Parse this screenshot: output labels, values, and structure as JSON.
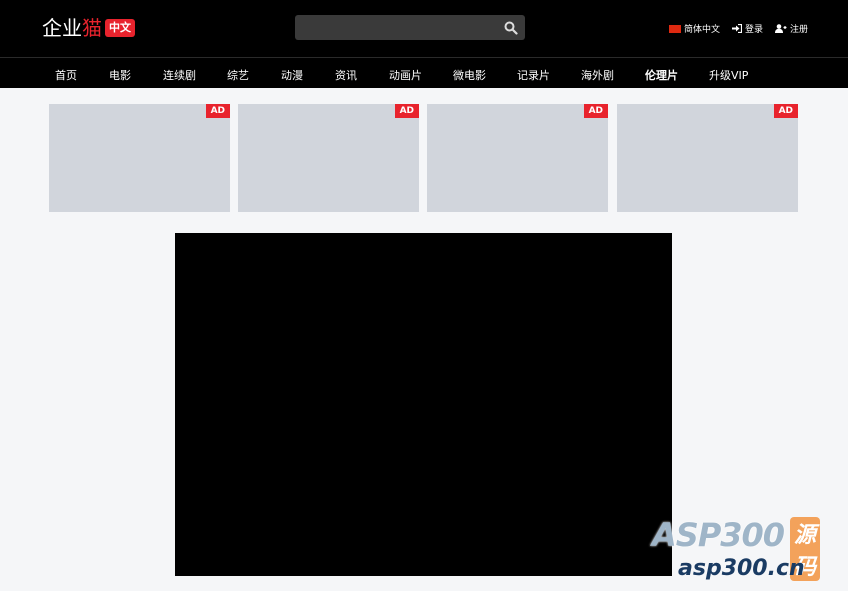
{
  "header": {
    "logo_white": "企业",
    "logo_red": "猫",
    "logo_badge": "中文",
    "search_placeholder": "",
    "language": "简体中文",
    "login": "登录",
    "register": "注册"
  },
  "nav": {
    "items": [
      "首页",
      "电影",
      "连续剧",
      "综艺",
      "动漫",
      "资讯",
      "动画片",
      "微电影",
      "记录片",
      "海外剧",
      "伦理片",
      "升级VIP"
    ],
    "active_index": 10
  },
  "ads": {
    "badge": "AD",
    "count": 4
  },
  "watermark": {
    "brand": "ASP300",
    "badge": "源码",
    "url": "asp300.cn"
  },
  "colors": {
    "accent": "#e8232d",
    "header_bg": "#000000",
    "page_bg": "#f5f6f8",
    "ad_placeholder": "#d1d5dc"
  },
  "icons": {
    "search": "search-icon",
    "login": "sign-in-icon",
    "register": "user-plus-icon",
    "language": "china-flag-icon"
  }
}
